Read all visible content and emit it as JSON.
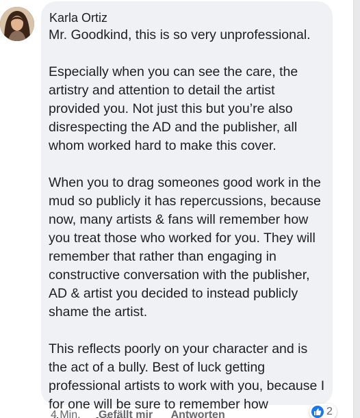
{
  "comment": {
    "author": "Karla Ortiz",
    "paragraphs": [
      "Mr. Goodkind, this is so very unprofessional.",
      "Especially when you can see the care, the artistry and attention to detail the artist provided you. Not just this but you’re also disrespecting the AD and the publisher, all whom worked hard to make this cover.",
      " When you to drag someones good work in the mud so publicly it has repercussions, because now, many artists & fans will remember how you treat those who worked for you. They will remember that rather than engaging in constructive conversation with the publisher, AD & artist you decided to instead publicly shame the artist.",
      "This reflects poorly on your character and is the act of a bully. Best of luck getting professional artists to work with you, because I for one will be sure to remember how distasteful this was."
    ]
  },
  "actions": {
    "timestamp": "4 Min.",
    "like_label": "Gefällt mir",
    "reply_label": "Antworten"
  },
  "reactions": {
    "icon": "thumbs-up-icon",
    "count": "2"
  },
  "colors": {
    "bubble": "#f0f1f4",
    "text": "#1c1e21",
    "meta": "#65676b",
    "like": "#1877f2"
  }
}
